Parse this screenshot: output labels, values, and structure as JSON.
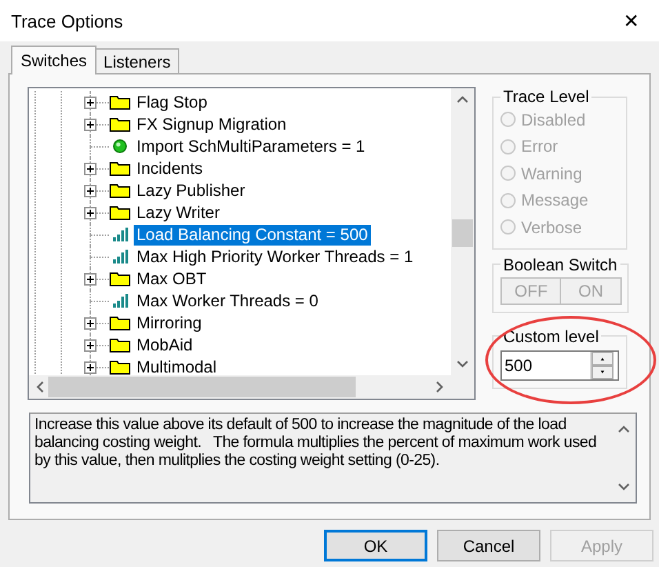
{
  "window": {
    "title": "Trace Options",
    "close": "✕"
  },
  "tabs": [
    {
      "label": "Switches",
      "selected": true
    },
    {
      "label": "Listeners",
      "selected": false
    }
  ],
  "tree": {
    "items": [
      {
        "kind": "folder",
        "label": "Flag Stop",
        "expanded": false,
        "selected": false
      },
      {
        "kind": "folder",
        "label": "FX Signup Migration",
        "expanded": false,
        "selected": false
      },
      {
        "kind": "bool",
        "label": "Import SchMultiParameters = 1",
        "selected": false
      },
      {
        "kind": "folder",
        "label": "Incidents",
        "expanded": false,
        "selected": false
      },
      {
        "kind": "folder",
        "label": "Lazy Publisher",
        "expanded": false,
        "selected": false
      },
      {
        "kind": "folder",
        "label": "Lazy Writer",
        "expanded": false,
        "selected": false
      },
      {
        "kind": "value",
        "label": "Load Balancing Constant = 500",
        "selected": true
      },
      {
        "kind": "value",
        "label": "Max High Priority Worker Threads = 1",
        "selected": false
      },
      {
        "kind": "folder",
        "label": "Max OBT",
        "expanded": false,
        "selected": false
      },
      {
        "kind": "value",
        "label": "Max Worker Threads = 0",
        "selected": false
      },
      {
        "kind": "folder",
        "label": "Mirroring",
        "expanded": false,
        "selected": false
      },
      {
        "kind": "folder",
        "label": "MobAid",
        "expanded": false,
        "selected": false
      },
      {
        "kind": "folder",
        "label": "Multimodal",
        "expanded": false,
        "selected": false
      }
    ]
  },
  "trace_level": {
    "title": "Trace Level",
    "options": [
      {
        "label": "Disabled",
        "checked": false,
        "disabled": true
      },
      {
        "label": "Error",
        "checked": false,
        "disabled": true
      },
      {
        "label": "Warning",
        "checked": false,
        "disabled": true
      },
      {
        "label": "Message",
        "checked": false,
        "disabled": true
      },
      {
        "label": "Verbose",
        "checked": false,
        "disabled": true
      }
    ]
  },
  "boolean_switch": {
    "title": "Boolean Switch",
    "buttons": [
      {
        "label": "OFF",
        "disabled": true
      },
      {
        "label": "ON",
        "disabled": true
      }
    ]
  },
  "custom_level": {
    "title": "Custom level",
    "value": "500",
    "highlighted": true
  },
  "description": "Increase this value above its default of 500 to increase the magnitude of the load balancing costing weight.   The formula multiplies the percent of maximum work used by this value, then mulitplies the costing weight setting (0-25).",
  "buttons": [
    {
      "label": "OK",
      "disabled": false,
      "default": true
    },
    {
      "label": "Cancel",
      "disabled": false,
      "default": false
    },
    {
      "label": "Apply",
      "disabled": true,
      "default": false
    }
  ]
}
